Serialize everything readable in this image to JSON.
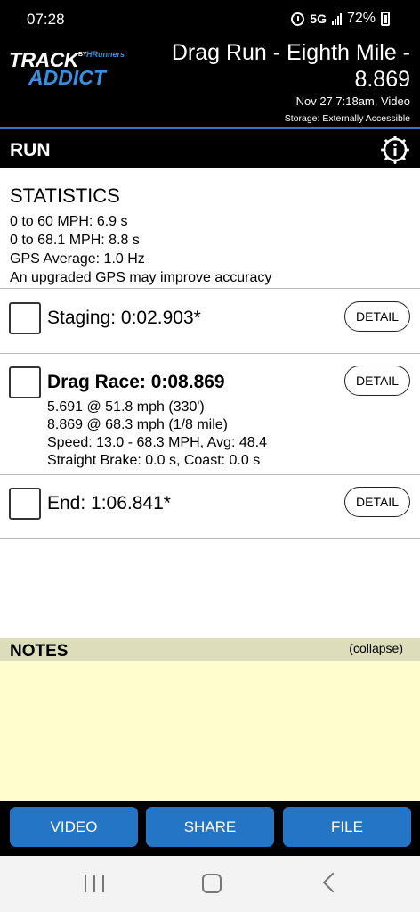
{
  "status_bar": {
    "time": "07:28",
    "network": "5G",
    "battery": "72%"
  },
  "header": {
    "logo": {
      "track": "TRACK",
      "addict": "ADDICT",
      "by": "BY",
      "hr": "HRunners"
    },
    "title": "Drag Run - Eighth Mile - 8.869",
    "subtitle": "Nov 27 7:18am, Video",
    "storage": "Storage: Externally Accessible"
  },
  "section": {
    "label": "RUN",
    "info_icon": "info-icon"
  },
  "statistics": {
    "heading": "STATISTICS",
    "lines": [
      "0 to 60 MPH: 6.9 s",
      "0 to 68.1 MPH: 8.8 s",
      "GPS Average: 1.0 Hz",
      "An upgraded GPS may improve accuracy"
    ]
  },
  "items": [
    {
      "title": "Staging:  0:02.903*",
      "details": [],
      "button": "DETAIL"
    },
    {
      "title": "Drag Race: 0:08.869",
      "details": [
        "5.691 @ 51.8 mph (330')",
        "8.869 @ 68.3 mph (1/8 mile)",
        "Speed: 13.0 - 68.3 MPH, Avg: 48.4",
        "Straight Brake: 0.0 s, Coast: 0.0 s"
      ],
      "button": "DETAIL"
    },
    {
      "title": "End:  1:06.841*",
      "details": [],
      "button": "DETAIL"
    }
  ],
  "notes": {
    "label": "NOTES",
    "collapse": "(collapse)",
    "text": ""
  },
  "buttons": {
    "video": "VIDEO",
    "share": "SHARE",
    "file": "FILE"
  },
  "colors": {
    "accent_blue": "#2575c6",
    "header_line": "#3a70c8",
    "notes_bg": "#fdfdcd",
    "notes_header_bg": "#ddddbb"
  }
}
